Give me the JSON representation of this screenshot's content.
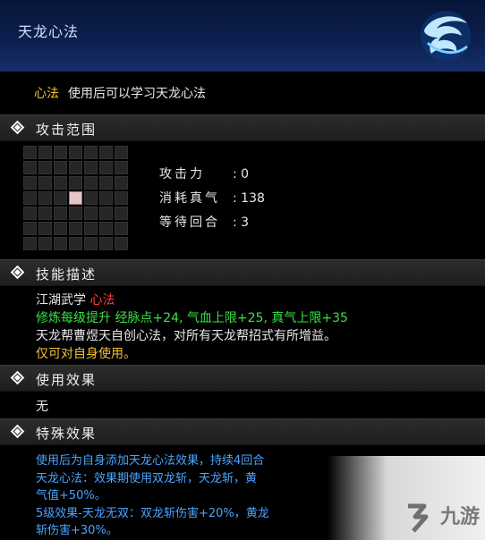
{
  "header": {
    "title": "天龙心法",
    "emblem_icon": "dragon-swirl-icon"
  },
  "subtitle": {
    "tag": "心法",
    "text": "使用后可以学习天龙心法"
  },
  "sections": {
    "range": {
      "label": "攻击范围"
    },
    "desc": {
      "label": "技能描述"
    },
    "use": {
      "label": "使用效果"
    },
    "special": {
      "label": "特殊效果"
    }
  },
  "range_grid": {
    "size": 7,
    "highlight": "center"
  },
  "stats": [
    {
      "label": "攻击力",
      "value": "0"
    },
    {
      "label": "消耗真气",
      "value": "138"
    },
    {
      "label": "等待回合",
      "value": "3"
    }
  ],
  "desc": {
    "line1_prefix": "江湖武学",
    "line1_tag": "心法",
    "line2": "修炼每级提升 经脉点+24, 气血上限+25, 真气上限+35",
    "line3": "天龙帮曹煜天自创心法，对所有天龙帮招式有所增益。",
    "line4": "仅可对自身使用。"
  },
  "use_effect": "无",
  "special": {
    "line1": "使用后为自身添加天龙心法效果，持续4回合",
    "line2": "天龙心法：效果期使用双龙斩，天龙斩，黄",
    "line3": "气值+50%。",
    "line4": "5级效果-天龙无双：双龙斩伤害+20%，黄龙",
    "line5": "斩伤害+30%。"
  },
  "watermark": {
    "text": "九游",
    "icon": "jiuyou-logo-icon"
  },
  "colors": {
    "header_bg": "#0c1f4e",
    "tag_yellow": "#f2c230",
    "tag_red": "#ff3b3b",
    "green": "#38e046",
    "blue": "#4aa4ff"
  }
}
